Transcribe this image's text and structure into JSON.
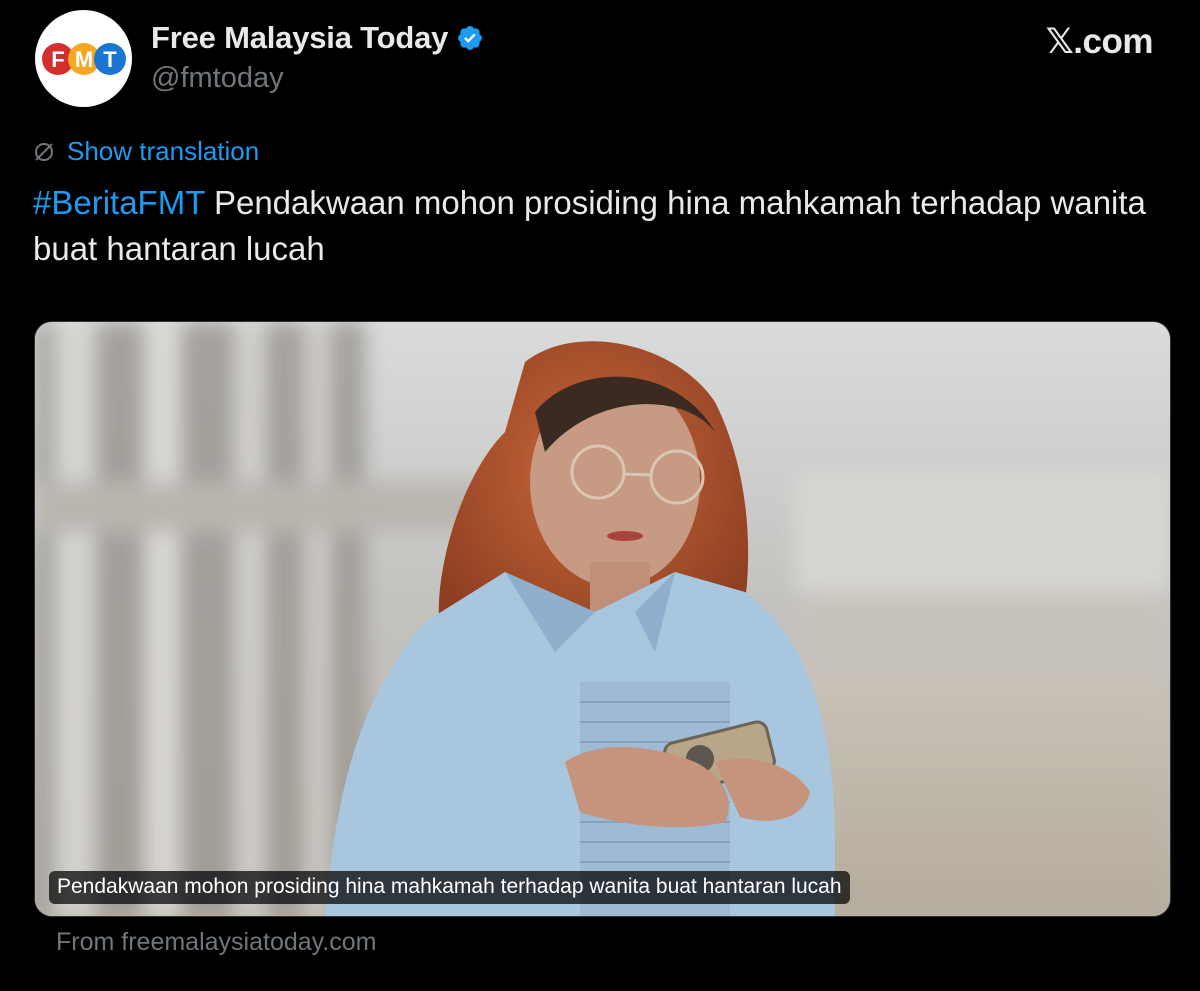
{
  "account": {
    "display_name": "Free Malaysia Today",
    "handle": "@fmtoday",
    "avatar_icon": "fmt-logo",
    "avatar_letters": [
      "F",
      "M",
      "T"
    ],
    "avatar_colors": [
      "#d32f2f",
      "#f5a623",
      "#1976d2"
    ],
    "verified_icon": "verified-badge-icon",
    "verified_color": "#1d9bf0"
  },
  "brand": {
    "label": "𝕏.com"
  },
  "translation": {
    "icon": "translate-globe-icon",
    "label": "Show translation"
  },
  "tweet": {
    "hashtag": "#BeritaFMT",
    "body": " Pendakwaan mohon prosiding hina mahkamah terhadap wanita buat hantaran lucah"
  },
  "media": {
    "caption": "Pendakwaan mohon prosiding hina mahkamah terhadap wanita buat hantaran lucah"
  },
  "link_source": {
    "label": "From freemalaysiatoday.com"
  },
  "colors": {
    "background": "#000000",
    "text_primary": "#e7e9ea",
    "text_secondary": "#71767b",
    "accent": "#1d9bf0"
  }
}
